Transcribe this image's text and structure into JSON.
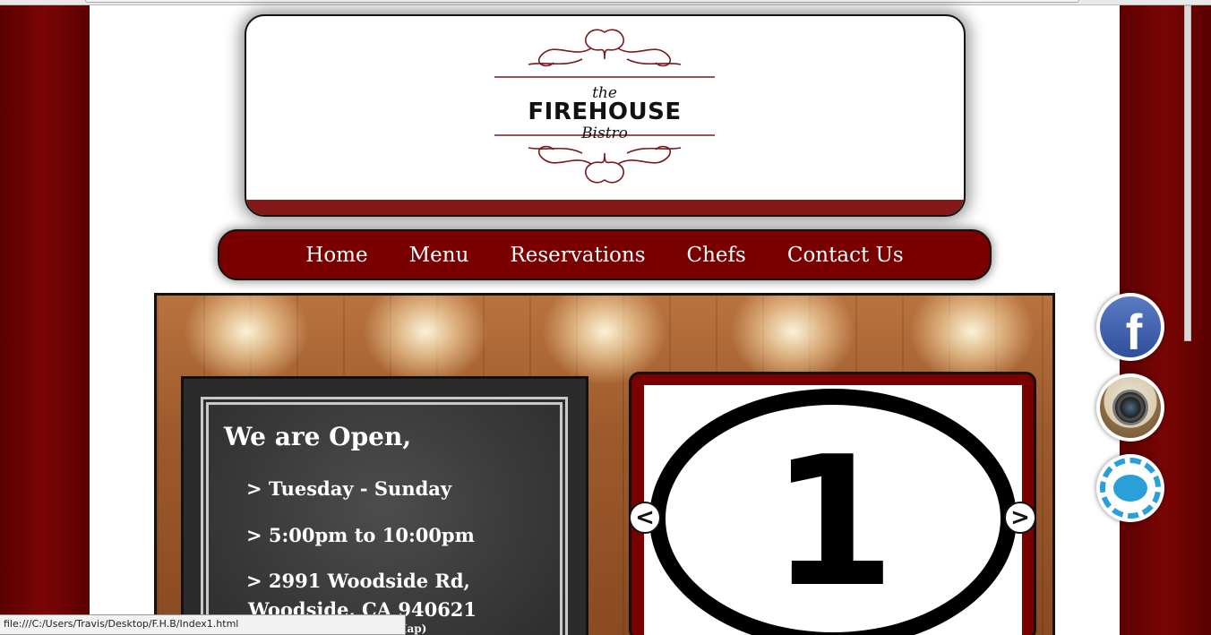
{
  "logo": {
    "the": "the",
    "main": "FIREHOUSE",
    "sub": "Bistro"
  },
  "nav": {
    "items": [
      "Home",
      "Menu",
      "Reservations",
      "Chefs",
      "Contact Us"
    ]
  },
  "hours": {
    "heading": "We are Open,",
    "days": "> Tuesday - Sunday",
    "time": "> 5:00pm to 10:00pm",
    "address1": "> 2991 Woodside Rd,",
    "address2": "Woodside, CA 940621",
    "map_hint": "k for Map)"
  },
  "slider": {
    "number": "1",
    "prev": "<",
    "next": ">"
  },
  "social": {
    "facebook_glyph": "f"
  },
  "status_bar": {
    "url": "file:///C:/Users/Travis/Desktop/F.H.B/Index1.html"
  },
  "colors": {
    "brand_red": "#7a0000",
    "band_red": "#851818",
    "background": "#6b0000"
  }
}
